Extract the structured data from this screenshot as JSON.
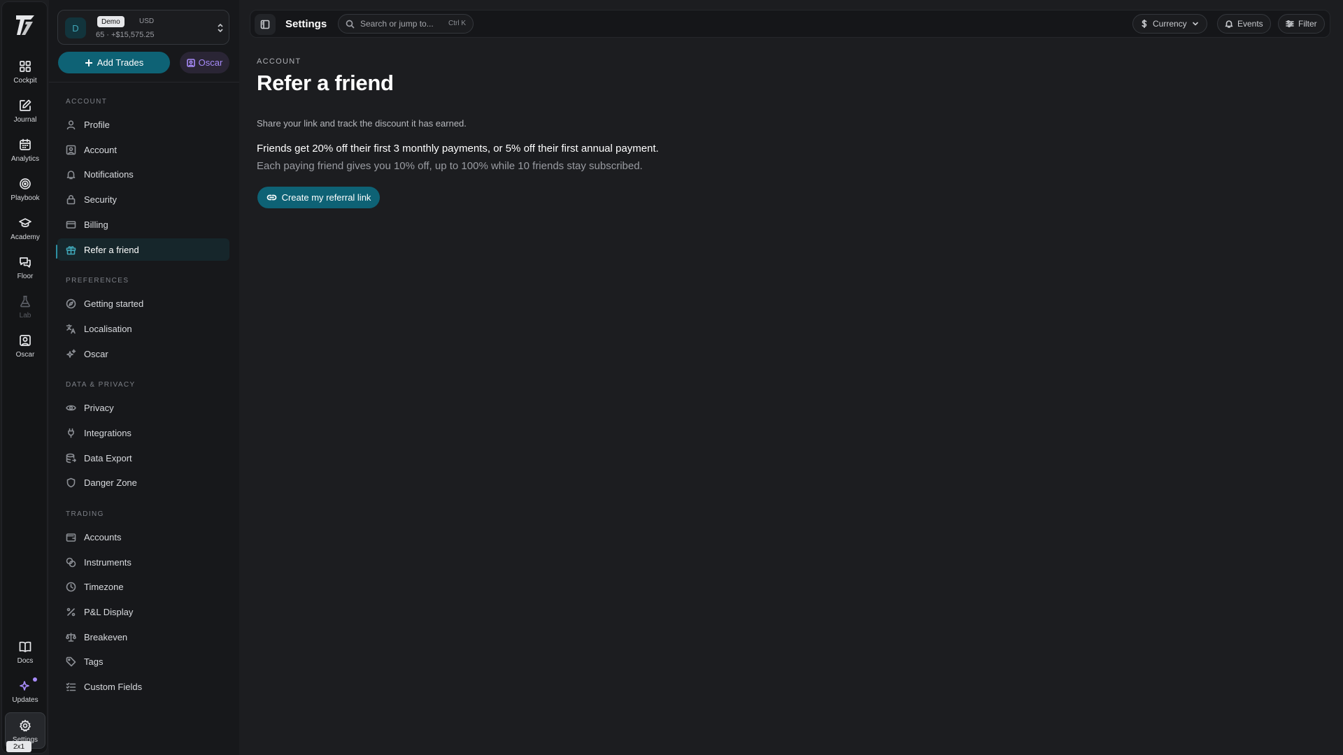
{
  "rail": {
    "items": [
      {
        "label": "Cockpit",
        "icon": "grid-icon"
      },
      {
        "label": "Journal",
        "icon": "edit-icon"
      },
      {
        "label": "Analytics",
        "icon": "calendar-icon"
      },
      {
        "label": "Playbook",
        "icon": "target-icon"
      },
      {
        "label": "Academy",
        "icon": "graduation-cap-icon"
      },
      {
        "label": "Floor",
        "icon": "chat-icon"
      },
      {
        "label": "Lab",
        "icon": "flask-icon"
      },
      {
        "label": "Oscar",
        "icon": "user-square-icon"
      }
    ],
    "bottom": [
      {
        "label": "Docs",
        "icon": "book-icon"
      },
      {
        "label": "Updates",
        "icon": "sparkle-icon"
      },
      {
        "label": "Settings",
        "icon": "gear-icon"
      }
    ],
    "size_badge": "2x1"
  },
  "account": {
    "avatar": "D",
    "badge": "Demo",
    "currency": "USD",
    "summary": "65 · +$15,575.25"
  },
  "actions": {
    "add_trades": "Add Trades",
    "oscar": "Oscar"
  },
  "sections": [
    {
      "title": "ACCOUNT",
      "items": [
        "Profile",
        "Account",
        "Notifications",
        "Security",
        "Billing",
        "Refer a friend"
      ]
    },
    {
      "title": "PREFERENCES",
      "items": [
        "Getting started",
        "Localisation",
        "Oscar"
      ]
    },
    {
      "title": "DATA & PRIVACY",
      "items": [
        "Privacy",
        "Integrations",
        "Data Export",
        "Danger Zone"
      ]
    },
    {
      "title": "TRADING",
      "items": [
        "Accounts",
        "Instruments",
        "Timezone",
        "P&L Display",
        "Breakeven",
        "Tags",
        "Custom Fields"
      ]
    }
  ],
  "topbar": {
    "title": "Settings",
    "search_placeholder": "Search or jump to...",
    "search_shortcut": "Ctrl K",
    "currency": "Currency",
    "events": "Events",
    "filter": "Filter"
  },
  "main": {
    "kicker": "ACCOUNT",
    "title": "Refer a friend",
    "description": "Share your link and track the discount it has earned.",
    "offer": "Friends get 20% off their first 3 monthly payments, or 5% off their first annual payment.",
    "offer_sub": "Each paying friend gives you 10% off, up to 100% while 10 friends stay subscribed.",
    "cta": "Create my referral link"
  },
  "colors": {
    "accent": "#0e6275",
    "accent_light": "#3fa6b7",
    "oscar": "#a78bfa",
    "background": "#1c1d20"
  }
}
